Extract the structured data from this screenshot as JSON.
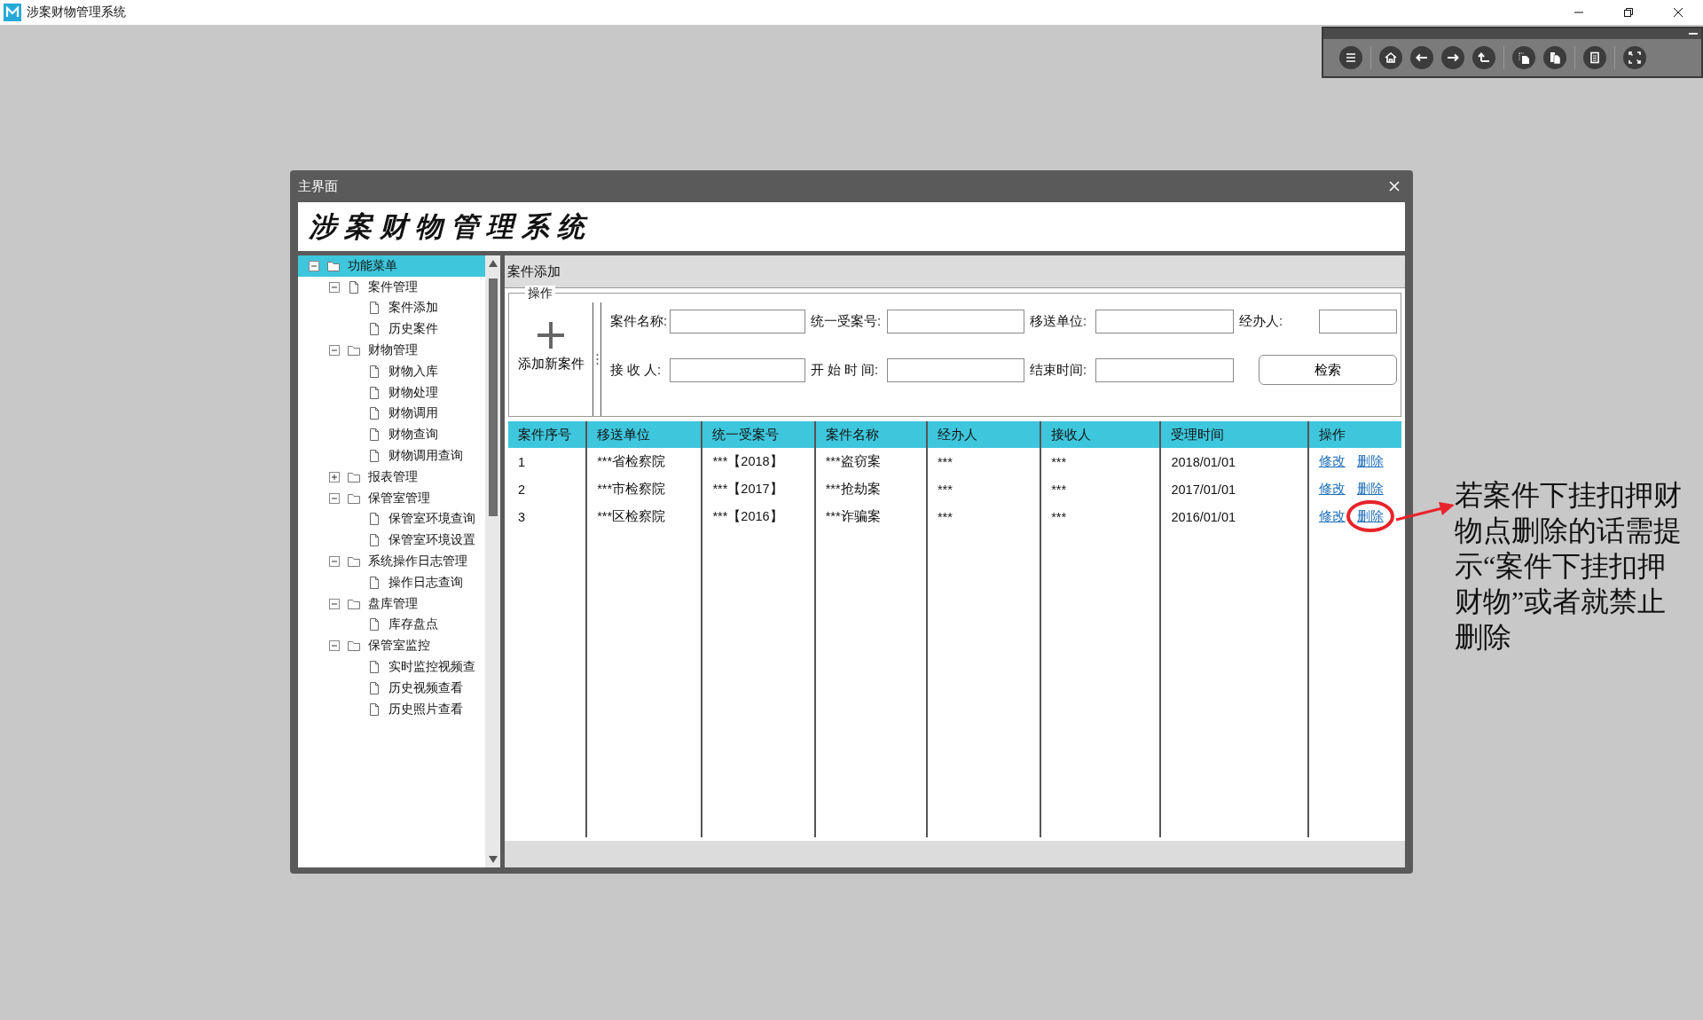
{
  "app": {
    "title": "涉案财物管理系统"
  },
  "dialog": {
    "title": "主界面",
    "banner": "涉案财物管理系统"
  },
  "tree": {
    "items": [
      {
        "label": "功能菜单",
        "kind": "folder",
        "expanded": true,
        "selected": true,
        "children": [
          {
            "label": "案件管理",
            "kind": "file",
            "expanded": true,
            "selected": false,
            "children": [
              {
                "label": "案件添加",
                "kind": "file",
                "selected": false
              },
              {
                "label": "历史案件",
                "kind": "file",
                "selected": false
              }
            ]
          },
          {
            "label": "财物管理",
            "kind": "folder",
            "expanded": true,
            "selected": false,
            "children": [
              {
                "label": "财物入库",
                "kind": "file",
                "selected": false
              },
              {
                "label": "财物处理",
                "kind": "file",
                "selected": false
              },
              {
                "label": "财物调用",
                "kind": "file",
                "selected": false
              },
              {
                "label": "财物查询",
                "kind": "file",
                "selected": false
              },
              {
                "label": "财物调用查询",
                "kind": "file",
                "selected": false
              }
            ]
          },
          {
            "label": "报表管理",
            "kind": "folder",
            "expanded": false,
            "selected": false
          },
          {
            "label": "保管室管理",
            "kind": "folder",
            "expanded": true,
            "selected": false,
            "children": [
              {
                "label": "保管室环境查询",
                "kind": "file",
                "selected": false
              },
              {
                "label": "保管室环境设置",
                "kind": "file",
                "selected": false
              }
            ]
          },
          {
            "label": "系统操作日志管理",
            "kind": "folder",
            "expanded": true,
            "selected": false,
            "children": [
              {
                "label": "操作日志查询",
                "kind": "file",
                "selected": false
              }
            ]
          },
          {
            "label": "盘库管理",
            "kind": "folder",
            "expanded": true,
            "selected": false,
            "children": [
              {
                "label": "库存盘点",
                "kind": "file",
                "selected": false
              }
            ]
          },
          {
            "label": "保管室监控",
            "kind": "folder",
            "expanded": true,
            "selected": false,
            "children": [
              {
                "label": "实时监控视频查",
                "kind": "file",
                "selected": false
              },
              {
                "label": "历史视频查看",
                "kind": "file",
                "selected": false
              },
              {
                "label": "历史照片查看",
                "kind": "file",
                "selected": false
              }
            ]
          }
        ]
      }
    ]
  },
  "panel": {
    "title": "案件添加"
  },
  "form": {
    "group_label": "操作",
    "add_button": "添加新案件",
    "fields": [
      {
        "label": "案件名称:"
      },
      {
        "label": "统一受案号:"
      },
      {
        "label": "移送单位:"
      },
      {
        "label": "经办人:"
      },
      {
        "label": "接 收 人:"
      },
      {
        "label": "开 始 时 间:"
      },
      {
        "label": "结束时间:"
      }
    ],
    "search_button": "检索"
  },
  "table": {
    "columns": [
      "案件序号",
      "移送单位",
      "统一受案号",
      "案件名称",
      "经办人",
      "接收人",
      "受理时间",
      "操作"
    ],
    "rows": [
      {
        "cells": [
          "1",
          "***省检察院",
          "***【2018】",
          "***盗窃案",
          "***",
          "***",
          "2018/01/01"
        ],
        "actions": [
          {
            "label": "修改",
            "highlighted": false
          },
          {
            "label": "删除",
            "highlighted": false
          }
        ]
      },
      {
        "cells": [
          "2",
          "***市检察院",
          "***【2017】",
          "***抢劫案",
          "***",
          "***",
          "2017/01/01"
        ],
        "actions": [
          {
            "label": "修改",
            "highlighted": false
          },
          {
            "label": "删除",
            "highlighted": false
          }
        ]
      },
      {
        "cells": [
          "3",
          "***区检察院",
          "***【2016】",
          "***诈骗案",
          "***",
          "***",
          "2016/01/01"
        ],
        "actions": [
          {
            "label": "修改",
            "highlighted": false
          },
          {
            "label": "删除",
            "highlighted": true
          }
        ]
      }
    ]
  },
  "annotation": {
    "text": "若案件下挂扣押财物点删除的话需提示“案件下挂扣押财物”或者就禁止删除"
  }
}
